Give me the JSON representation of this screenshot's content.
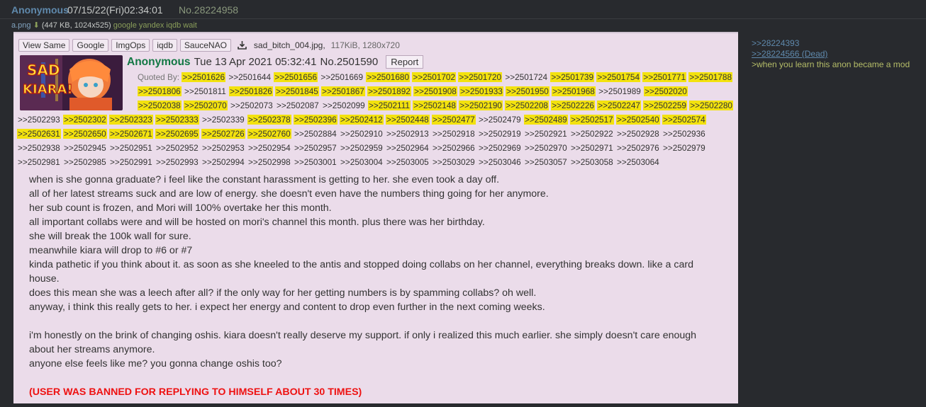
{
  "outer": {
    "name": "Anonymous",
    "date": "07/15/22(Fri)02:34:01",
    "no_label": "No.",
    "no": "28224958",
    "file_name": "a.png",
    "file_info": "(447 KB, 1024x525)",
    "file_links": "google yandex iqdb wait"
  },
  "toolbar": {
    "buttons": [
      "View Same",
      "Google",
      "ImgOps",
      "iqdb",
      "SauceNAO"
    ],
    "file_name": "sad_bitch_004.jpg,",
    "file_meta": "117KiB, 1280x720"
  },
  "thumbnail": {
    "text_line1": "SAD",
    "text_line2": "KIARA!"
  },
  "post": {
    "name": "Anonymous",
    "date": "Tue 13 Apr 2021 05:32:41",
    "no": "No.2501590",
    "report": "Report"
  },
  "quoted_label": "Quoted By:",
  "quotes": [
    {
      "t": ">>2501626",
      "h": true
    },
    {
      "t": ">>2501644",
      "h": false
    },
    {
      "t": ">>2501656",
      "h": true
    },
    {
      "t": ">>2501669",
      "h": false
    },
    {
      "t": ">>2501680",
      "h": true
    },
    {
      "t": ">>2501702",
      "h": true
    },
    {
      "t": ">>2501720",
      "h": true
    },
    {
      "t": ">>2501724",
      "h": false
    },
    {
      "t": ">>2501739",
      "h": true
    },
    {
      "t": ">>2501754",
      "h": true
    },
    {
      "t": ">>2501771",
      "h": true
    },
    {
      "t": ">>2501788",
      "h": true
    },
    {
      "t": ">>2501806",
      "h": true
    },
    {
      "t": ">>2501811",
      "h": false
    },
    {
      "t": ">>2501826",
      "h": true
    },
    {
      "t": ">>2501845",
      "h": true
    },
    {
      "t": ">>2501867",
      "h": true
    },
    {
      "t": ">>2501892",
      "h": true
    },
    {
      "t": ">>2501908",
      "h": true
    },
    {
      "t": ">>2501933",
      "h": true
    },
    {
      "t": ">>2501950",
      "h": true
    },
    {
      "t": ">>2501968",
      "h": true
    },
    {
      "t": ">>2501989",
      "h": false
    },
    {
      "t": ">>2502020",
      "h": true
    },
    {
      "t": ">>2502038",
      "h": true
    },
    {
      "t": ">>2502070",
      "h": true
    },
    {
      "t": ">>2502073",
      "h": false
    },
    {
      "t": ">>2502087",
      "h": false
    },
    {
      "t": ">>2502099",
      "h": false
    },
    {
      "t": ">>2502111",
      "h": true
    },
    {
      "t": ">>2502148",
      "h": true
    },
    {
      "t": ">>2502190",
      "h": true
    },
    {
      "t": ">>2502208",
      "h": true
    },
    {
      "t": ">>2502226",
      "h": true
    },
    {
      "t": ">>2502247",
      "h": true
    },
    {
      "t": ">>2502259",
      "h": true
    },
    {
      "t": ">>2502280",
      "h": true
    },
    {
      "t": ">>2502293",
      "h": false
    },
    {
      "t": ">>2502302",
      "h": true
    },
    {
      "t": ">>2502323",
      "h": true
    },
    {
      "t": ">>2502333",
      "h": true
    },
    {
      "t": ">>2502339",
      "h": false
    },
    {
      "t": ">>2502378",
      "h": true
    },
    {
      "t": ">>2502396",
      "h": true
    },
    {
      "t": ">>2502412",
      "h": true
    },
    {
      "t": ">>2502448",
      "h": true
    },
    {
      "t": ">>2502477",
      "h": true
    },
    {
      "t": ">>2502479",
      "h": false
    },
    {
      "t": ">>2502489",
      "h": true
    },
    {
      "t": ">>2502517",
      "h": true
    },
    {
      "t": ">>2502540",
      "h": true
    },
    {
      "t": ">>2502574",
      "h": true
    },
    {
      "t": ">>2502631",
      "h": true
    },
    {
      "t": ">>2502650",
      "h": true
    },
    {
      "t": ">>2502671",
      "h": true
    },
    {
      "t": ">>2502695",
      "h": true
    },
    {
      "t": ">>2502726",
      "h": true
    },
    {
      "t": ">>2502760",
      "h": true
    },
    {
      "t": ">>2502884",
      "h": false
    },
    {
      "t": ">>2502910",
      "h": false
    },
    {
      "t": ">>2502913",
      "h": false
    },
    {
      "t": ">>2502918",
      "h": false
    },
    {
      "t": ">>2502919",
      "h": false
    },
    {
      "t": ">>2502921",
      "h": false
    },
    {
      "t": ">>2502922",
      "h": false
    },
    {
      "t": ">>2502928",
      "h": false
    },
    {
      "t": ">>2502936",
      "h": false
    },
    {
      "t": ">>2502938",
      "h": false
    },
    {
      "t": ">>2502945",
      "h": false
    },
    {
      "t": ">>2502951",
      "h": false
    },
    {
      "t": ">>2502952",
      "h": false
    },
    {
      "t": ">>2502953",
      "h": false
    },
    {
      "t": ">>2502954",
      "h": false
    },
    {
      "t": ">>2502957",
      "h": false
    },
    {
      "t": ">>2502959",
      "h": false
    },
    {
      "t": ">>2502964",
      "h": false
    },
    {
      "t": ">>2502966",
      "h": false
    },
    {
      "t": ">>2502969",
      "h": false
    },
    {
      "t": ">>2502970",
      "h": false
    },
    {
      "t": ">>2502971",
      "h": false
    },
    {
      "t": ">>2502976",
      "h": false
    },
    {
      "t": ">>2502979",
      "h": false
    },
    {
      "t": ">>2502981",
      "h": false
    },
    {
      "t": ">>2502985",
      "h": false
    },
    {
      "t": ">>2502991",
      "h": false
    },
    {
      "t": ">>2502993",
      "h": false
    },
    {
      "t": ">>2502994",
      "h": false
    },
    {
      "t": ">>2502998",
      "h": false
    },
    {
      "t": ">>2503001",
      "h": false
    },
    {
      "t": ">>2503004",
      "h": false
    },
    {
      "t": ">>2503005",
      "h": false
    },
    {
      "t": ">>2503029",
      "h": false
    },
    {
      "t": ">>2503046",
      "h": false
    },
    {
      "t": ">>2503057",
      "h": false
    },
    {
      "t": ">>2503058",
      "h": false
    },
    {
      "t": ">>2503064",
      "h": false
    }
  ],
  "body": {
    "lines": [
      "when is she gonna graduate? i feel like the constant harassment is getting to her. she even took a day off.",
      "all of her latest streams suck and are low of energy. she doesn't even have the numbers thing going for her anymore.",
      "her sub count is frozen, and Mori will 100% overtake her this month.",
      "all important collabs were and will be hosted on mori's channel this month. plus there was her birthday.",
      "she will break the 100k wall for sure.",
      "meanwhile kiara will drop to #6 or #7",
      "kinda pathetic if you think about it. as soon as she kneeled to the antis and stopped doing collabs on her channel, everything breaks down. like a card house.",
      "does this mean she was a leech after all? if the only way for her getting numbers is by spamming collabs? oh well.",
      "anyway, i think this really gets to her. i expect her energy and content to drop even further in the next coming weeks.",
      "",
      "i'm honestly on the brink of changing oshis. kiara doesn't really deserve my support. if only i realized this much earlier. she simply doesn't care enough about her streams anymore.",
      "anyone else feels like me? you gonna change oshis too?",
      ""
    ],
    "banned": "(USER WAS BANNED FOR REPLYING TO HIMSELF ABOUT 30 TIMES)"
  },
  "right_column": {
    "link1": ">>28224393",
    "link2": ">>28224566 (Dead)",
    "greentext": ">when you learn this anon became a mod"
  },
  "colors": {
    "background": "#282a2e",
    "post_bg": "#ebdcea",
    "highlight": "#f3e20e",
    "name_green": "#117743",
    "banned_red": "#ee1111"
  }
}
